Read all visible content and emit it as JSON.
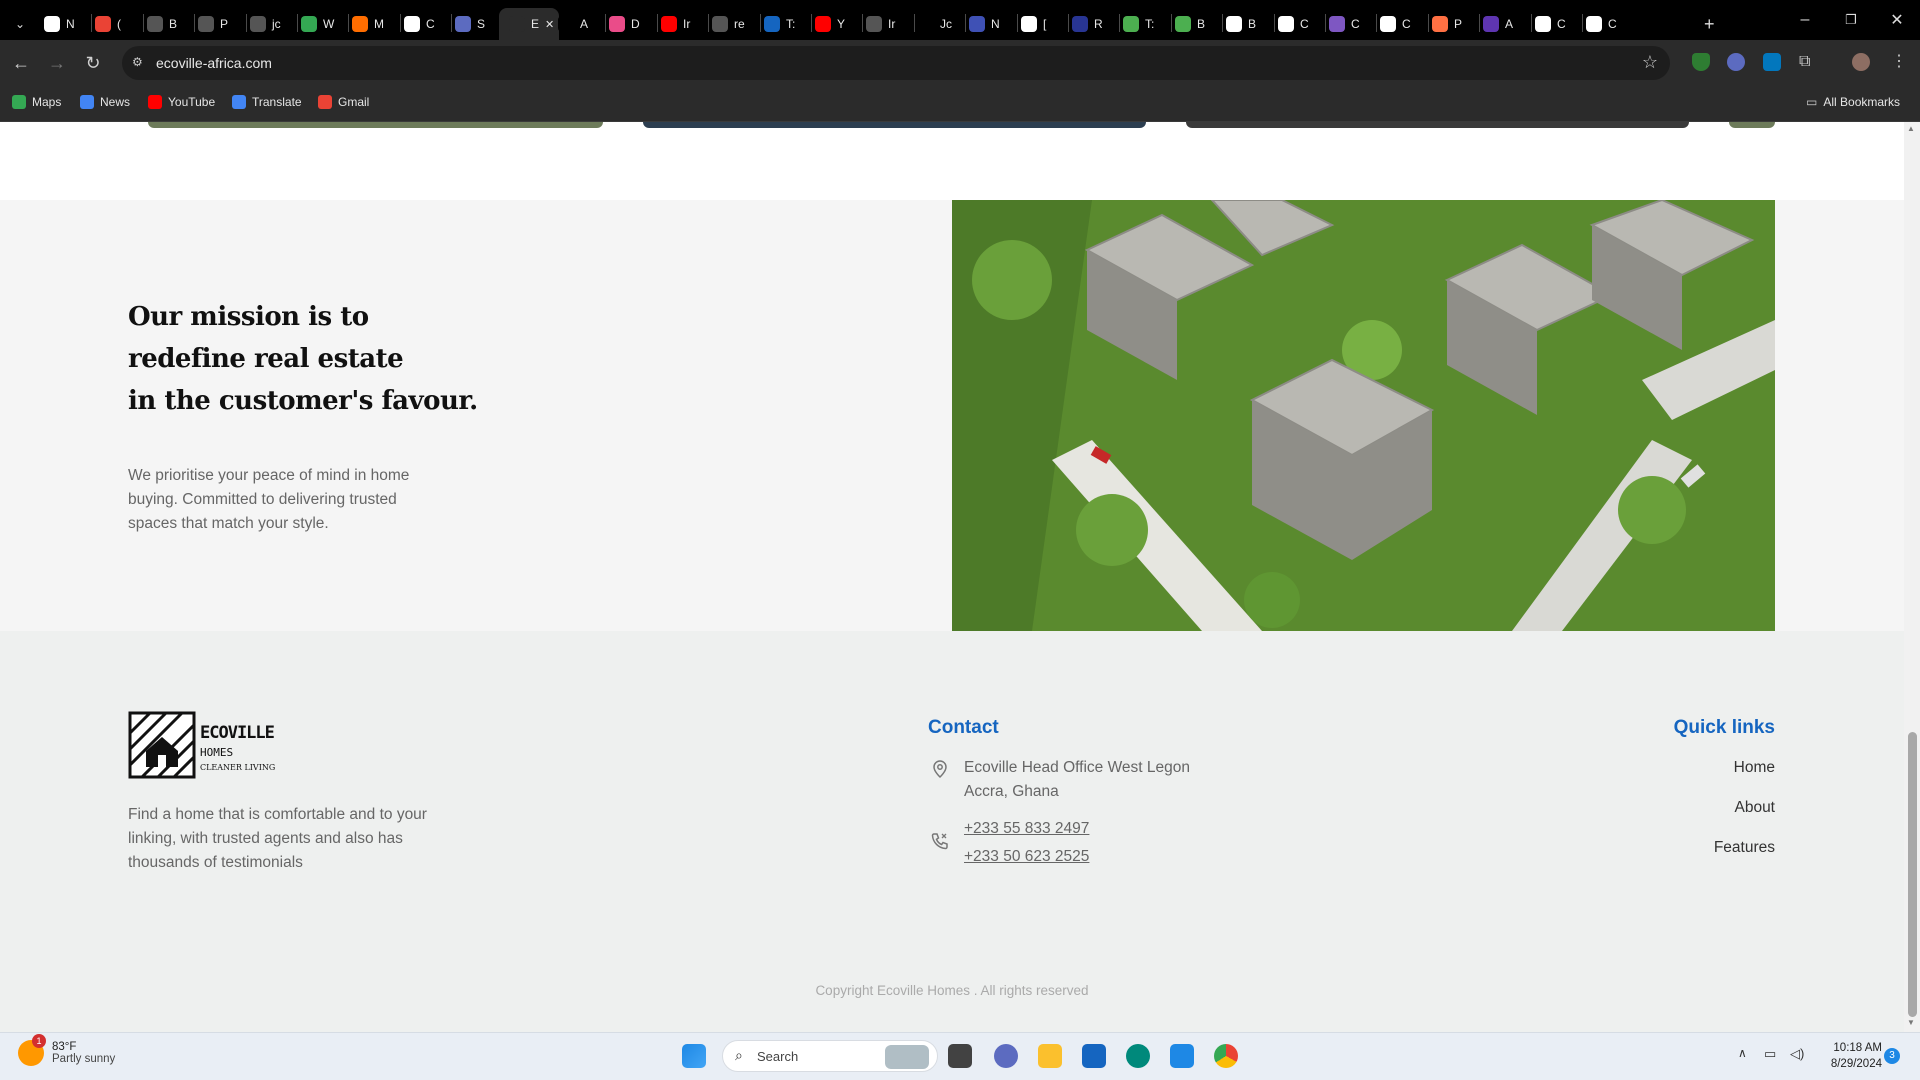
{
  "browser": {
    "tabs": [
      {
        "label": "N",
        "color": "#ffffff"
      },
      {
        "label": "(",
        "color": "#ea4335"
      },
      {
        "label": "B",
        "color": "#555555"
      },
      {
        "label": "P",
        "color": "#555555"
      },
      {
        "label": "jc",
        "color": "#555555"
      },
      {
        "label": "W",
        "color": "#34a853"
      },
      {
        "label": "M",
        "color": "#ff6d00"
      },
      {
        "label": "C",
        "color": "#ffffff"
      },
      {
        "label": "S",
        "color": "#5c6bc0"
      },
      {
        "label": "E",
        "color": "#2b2b2b",
        "active": true
      },
      {
        "label": "A",
        "color": "#000000"
      },
      {
        "label": "D",
        "color": "#ea4c89"
      },
      {
        "label": "Ir",
        "color": "#ff0000"
      },
      {
        "label": "re",
        "color": "#555555"
      },
      {
        "label": "T:",
        "color": "#1565c0"
      },
      {
        "label": "Y",
        "color": "#ff0000"
      },
      {
        "label": "Ir",
        "color": "#555555"
      },
      {
        "label": "Jc",
        "color": "#000000"
      },
      {
        "label": "N",
        "color": "#3f51b5"
      },
      {
        "label": "[",
        "color": "#ffffff"
      },
      {
        "label": "R",
        "color": "#283593"
      },
      {
        "label": "T:",
        "color": "#4caf50"
      },
      {
        "label": "B",
        "color": "#4caf50"
      },
      {
        "label": "B",
        "color": "#ffffff"
      },
      {
        "label": "C",
        "color": "#ffffff"
      },
      {
        "label": "C",
        "color": "#7e57c2"
      },
      {
        "label": "C",
        "color": "#ffffff"
      },
      {
        "label": "P",
        "color": "#ff7043"
      },
      {
        "label": "A",
        "color": "#5e35b1"
      },
      {
        "label": "C",
        "color": "#ffffff"
      },
      {
        "label": "C",
        "color": "#ffffff"
      }
    ],
    "url": "ecoville-africa.com",
    "bookmarks": [
      "Maps",
      "News",
      "YouTube",
      "Translate",
      "Gmail"
    ],
    "all_bookmarks": "All Bookmarks"
  },
  "mission": {
    "heading_lines": [
      "Our mission is to",
      "redefine real estate",
      "in the customer's favour."
    ],
    "body": "We prioritise your peace of mind in home buying. Committed to delivering trusted spaces that match your style."
  },
  "footer": {
    "logo_text": "ECOVILLE",
    "logo_sub": "HOMES",
    "logo_tagline": "CLEANER LIVING",
    "description": "Find a home that is comfortable and to your linking, with trusted agents and also has thousands of testimonials",
    "contact_title": "Contact",
    "address_line1": "Ecoville Head Office West Legon",
    "address_line2": "Accra, Ghana",
    "phone1": "+233 55 833 2497",
    "phone2": "+233 50 623 2525",
    "quick_title": "Quick links",
    "quick_links": [
      "Home",
      "About",
      "Features"
    ],
    "copyright": "Copyright Ecoville Homes . All rights reserved"
  },
  "taskbar": {
    "temp": "83°F",
    "weather": "Partly sunny",
    "weather_badge": "1",
    "search": "Search",
    "time": "10:18 AM",
    "date": "8/29/2024",
    "notif": "3"
  }
}
